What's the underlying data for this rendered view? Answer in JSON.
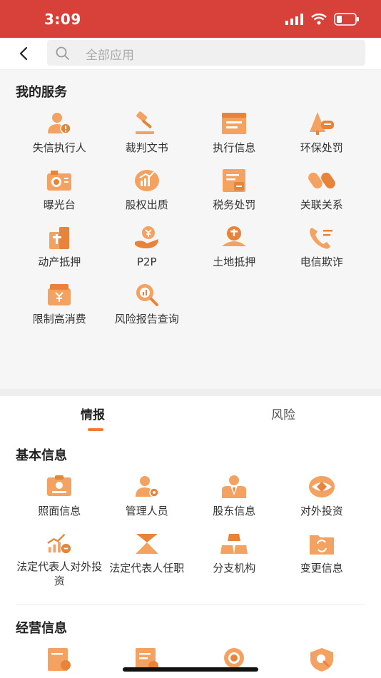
{
  "status": {
    "time": "3:09"
  },
  "search": {
    "placeholder": "全部应用"
  },
  "my_services": {
    "title": "我的服务",
    "items": [
      {
        "label": "失信执行人",
        "icon": "person-warning-icon"
      },
      {
        "label": "裁判文书",
        "icon": "gavel-icon"
      },
      {
        "label": "执行信息",
        "icon": "document-icon"
      },
      {
        "label": "环保处罚",
        "icon": "tree-penalty-icon"
      },
      {
        "label": "曝光台",
        "icon": "camera-icon"
      },
      {
        "label": "股权出质",
        "icon": "chart-coin-icon"
      },
      {
        "label": "税务处罚",
        "icon": "tax-icon"
      },
      {
        "label": "关联关系",
        "icon": "link-icon"
      },
      {
        "label": "动产抵押",
        "icon": "mortgage-icon"
      },
      {
        "label": "P2P",
        "icon": "yen-hand-icon"
      },
      {
        "label": "土地抵押",
        "icon": "land-mortgage-icon"
      },
      {
        "label": "电信欺诈",
        "icon": "phone-icon"
      },
      {
        "label": "限制高消费",
        "icon": "wallet-icon"
      },
      {
        "label": "风险报告查询",
        "icon": "report-search-icon"
      }
    ]
  },
  "tabs": [
    {
      "label": "情报"
    },
    {
      "label": "风险"
    }
  ],
  "basic_info": {
    "title": "基本信息",
    "items": [
      {
        "label": "照面信息",
        "icon": "id-card-icon"
      },
      {
        "label": "管理人员",
        "icon": "manager-icon"
      },
      {
        "label": "股东信息",
        "icon": "shareholder-icon"
      },
      {
        "label": "对外投资",
        "icon": "eye-investment-icon"
      },
      {
        "label": "法定代表人对外投资",
        "icon": "trend-coin-icon"
      },
      {
        "label": "法定代表人任职",
        "icon": "pyramid-icon"
      },
      {
        "label": "分支机构",
        "icon": "gold-bars-icon"
      },
      {
        "label": "变更信息",
        "icon": "folder-change-icon"
      }
    ]
  },
  "business_info": {
    "title": "经营信息",
    "items": [
      {
        "label": "",
        "icon": "doc-chart-icon"
      },
      {
        "label": "",
        "icon": "invoice-icon"
      },
      {
        "label": "",
        "icon": "badge-icon"
      },
      {
        "label": "",
        "icon": "shield-search-icon"
      }
    ]
  },
  "colors": {
    "status_bar": "#d8413a",
    "icon_accent": "#f4a261",
    "icon_dark": "#e8833a",
    "tab_underline": "#f07a3a"
  }
}
